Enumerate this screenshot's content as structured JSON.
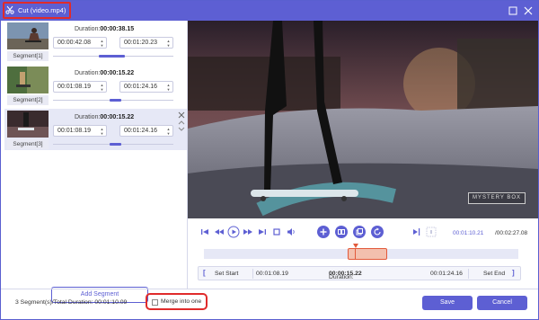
{
  "window": {
    "title": "Cut (video.mp4)"
  },
  "segments": [
    {
      "label": "Segment[1]",
      "duration_prefix": "Duration:",
      "duration": "00:00:38.15",
      "start": "00:00:42.08",
      "end": "00:01:20.23",
      "selected": false,
      "progress": 0.45
    },
    {
      "label": "Segment[2]",
      "duration_prefix": "Duration:",
      "duration": "00:00:15.22",
      "start": "00:01:08.19",
      "end": "00:01:24.16",
      "selected": false,
      "progress": 0.55
    },
    {
      "label": "Segment[3]",
      "duration_prefix": "Duration:",
      "duration": "00:00:15.22",
      "start": "00:01:08.19",
      "end": "00:01:24.16",
      "selected": true,
      "progress": 0.55
    }
  ],
  "add_segment_label": "Add Segment",
  "video": {
    "watermark": "MYSTERY BOX"
  },
  "player": {
    "time_current": "00:01:10.21",
    "time_total": "/00:02:27.08"
  },
  "set_bar": {
    "set_start_label": "Set Start",
    "start": "00:01:08.19",
    "duration_prefix": "Duration:",
    "duration": "00:00:15.22",
    "end": "00:01:24.16",
    "set_end_label": "Set End"
  },
  "footer": {
    "status": "3 Segment(s)/Total Duration: 00:01:10.09",
    "merge_label": "Merge into one",
    "merge_checked": false,
    "save_label": "Save",
    "cancel_label": "Cancel"
  },
  "colors": {
    "accent": "#5d5fd3",
    "highlight": "#e02b2b",
    "timeline_selection": "#e25a3b"
  }
}
